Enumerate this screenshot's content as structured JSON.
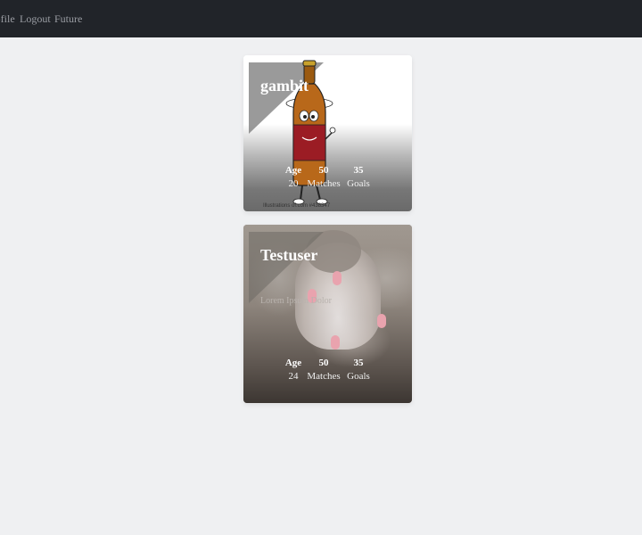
{
  "navbar": {
    "links": [
      {
        "label": "Profile"
      },
      {
        "label": "Logout"
      },
      {
        "label": "Future"
      }
    ]
  },
  "cards": [
    {
      "title": "gambit",
      "description": "",
      "watermark": "Illustrations of.com    #438347",
      "stats": [
        {
          "value": "Age",
          "label": "20"
        },
        {
          "value": "50",
          "label": "Matches"
        },
        {
          "value": "35",
          "label": "Goals"
        }
      ]
    },
    {
      "title": "Testuser",
      "description": "Lorem Ipsum Dolor",
      "stats": [
        {
          "value": "Age",
          "label": "24"
        },
        {
          "value": "50",
          "label": "Matches"
        },
        {
          "value": "35",
          "label": "Goals"
        }
      ]
    }
  ]
}
